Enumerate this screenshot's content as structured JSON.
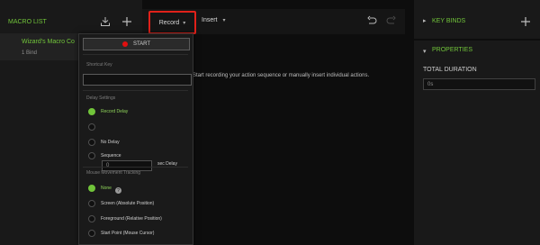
{
  "left": {
    "title": "MACRO LIST",
    "items": [
      {
        "title": "Wizard's Macro Co",
        "sub": "1 Bind"
      }
    ]
  },
  "center": {
    "record_label": "Record",
    "insert_label": "Insert",
    "message": "Start recording your action sequence or manually insert individual actions."
  },
  "dropdown": {
    "start_label": "START",
    "shortcut_key_label": "Shortcut Key",
    "delay_settings_label": "Delay Settings",
    "record_delay_label": "Record Delay",
    "delay_value": "0",
    "sec_delay_label": "sec Delay",
    "no_delay_label": "No Delay",
    "sequence_label": "Sequence",
    "info_symbol": "?",
    "mouse_tracking_label": "Mouse Movement Tracking",
    "none_label": "None",
    "screen_label": "Screen (Absolute Position)",
    "foreground_label": "Foreground (Relative Position)",
    "start_point_label": "Start Point (Mouse Cursor)"
  },
  "right": {
    "keybinds_title": "KEY BINDS",
    "properties_title": "PROPERTIES",
    "total_duration_label": "TOTAL DURATION",
    "total_duration_value": "0s"
  },
  "colors": {
    "accent": "#71c43a",
    "record_highlight": "#e1211a",
    "start_dot": "#e10f0f"
  }
}
